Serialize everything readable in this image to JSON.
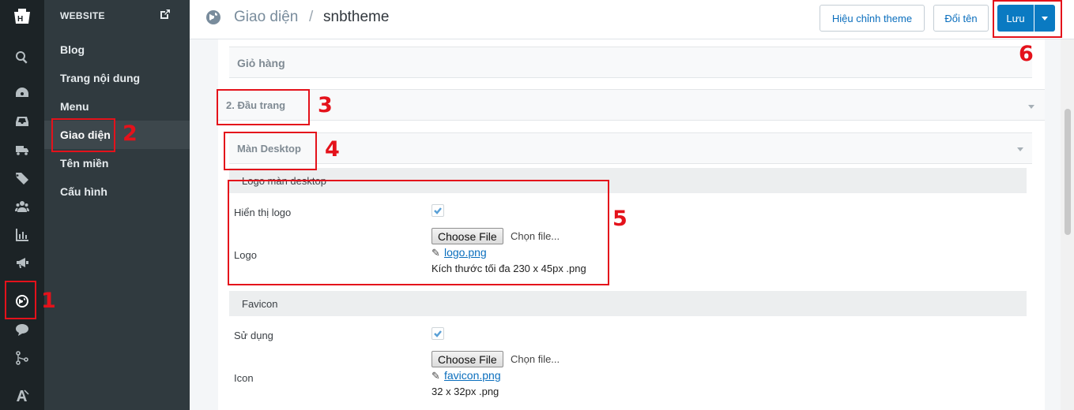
{
  "rail": {
    "icons": [
      "logo-icon",
      "search-icon",
      "dashboard-icon",
      "inbox-icon",
      "truck-icon",
      "tag-icon",
      "users-icon",
      "chart-icon",
      "megaphone-icon",
      "globe-icon",
      "chat-icon",
      "share-icon",
      "font-icon"
    ]
  },
  "panel": {
    "title": "WEBSITE",
    "items": [
      {
        "label": "Blog"
      },
      {
        "label": "Trang nội dung"
      },
      {
        "label": "Menu"
      },
      {
        "label": "Giao diện"
      },
      {
        "label": "Tên miền"
      },
      {
        "label": "Cấu hình"
      }
    ]
  },
  "header": {
    "parent": "Giao diện",
    "separator": "/",
    "current": "snbtheme",
    "edit_theme": "Hiệu chỉnh theme",
    "rename": "Đổi tên",
    "save": "Lưu"
  },
  "accordions": {
    "cart": "Giỏ hàng",
    "header_section": "2. Đầu trang",
    "desktop": "Màn Desktop"
  },
  "logo_section": {
    "title": "Logo màn desktop",
    "show_label": "Hiển thị logo",
    "logo_label": "Logo",
    "choose": "Choose File",
    "no_file": "Chọn file...",
    "file_name": "logo.png",
    "hint": "Kích thước tối đa 230 x 45px .png"
  },
  "favicon_section": {
    "title": "Favicon",
    "use_label": "Sử dụng",
    "icon_label": "Icon",
    "choose": "Choose File",
    "no_file": "Chọn file...",
    "file_name": "favicon.png",
    "hint": "32 x 32px .png"
  },
  "annotations": [
    "1",
    "2",
    "3",
    "4",
    "5",
    "6"
  ],
  "colors": {
    "accent": "#0a7ac2",
    "annotation": "#e4121b",
    "sidebar": "#303a3f",
    "rail": "#1c2326"
  }
}
